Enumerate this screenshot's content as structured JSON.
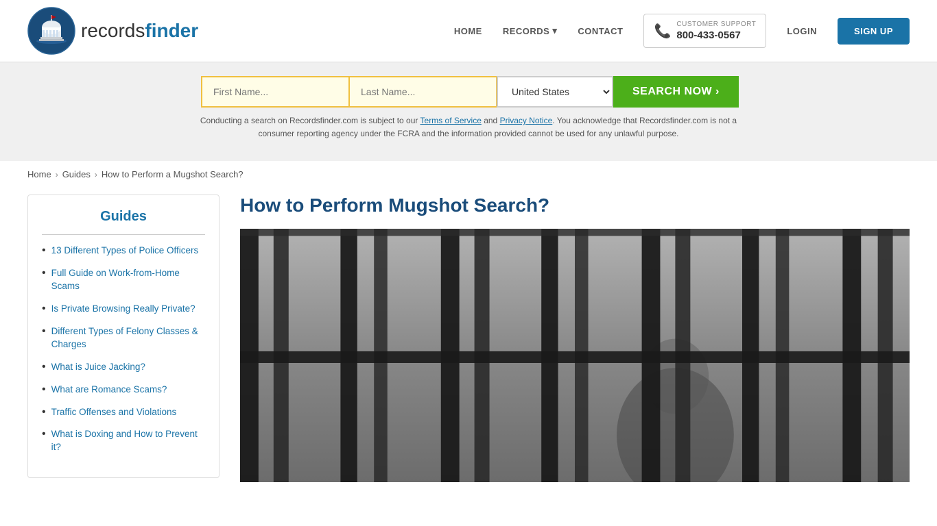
{
  "header": {
    "logo_text_light": "records",
    "logo_text_bold": "finder",
    "nav": {
      "home": "HOME",
      "records": "RECORDS",
      "records_arrow": "▾",
      "contact": "CONTACT",
      "support_label": "CUSTOMER SUPPORT",
      "support_number": "800-433-0567",
      "login": "LOGIN",
      "signup": "SIGN UP"
    }
  },
  "search": {
    "first_name_placeholder": "First Name...",
    "last_name_placeholder": "Last Name...",
    "country_value": "United States",
    "search_button": "SEARCH NOW ›",
    "disclaimer": "Conducting a search on Recordsfinder.com is subject to our Terms of Service and Privacy Notice. You acknowledge that Recordsfinder.com is not a consumer reporting agency under the FCRA and the information provided cannot be used for any unlawful purpose."
  },
  "breadcrumb": {
    "home": "Home",
    "guides": "Guides",
    "current": "How to Perform a Mugshot Search?"
  },
  "sidebar": {
    "title": "Guides",
    "items": [
      {
        "label": "13 Different Types of Police Officers",
        "href": "#"
      },
      {
        "label": "Full Guide on Work-from-Home Scams",
        "href": "#"
      },
      {
        "label": "Is Private Browsing Really Private?",
        "href": "#"
      },
      {
        "label": "Different Types of Felony Classes & Charges",
        "href": "#"
      },
      {
        "label": "What is Juice Jacking?",
        "href": "#"
      },
      {
        "label": "What are Romance Scams?",
        "href": "#"
      },
      {
        "label": "Traffic Offenses and Violations",
        "href": "#"
      },
      {
        "label": "What is Doxing and How to Prevent it?",
        "href": "#"
      }
    ]
  },
  "article": {
    "title": "How to Perform Mugshot Search?",
    "image_alt": "Jail bars black and white photo"
  }
}
